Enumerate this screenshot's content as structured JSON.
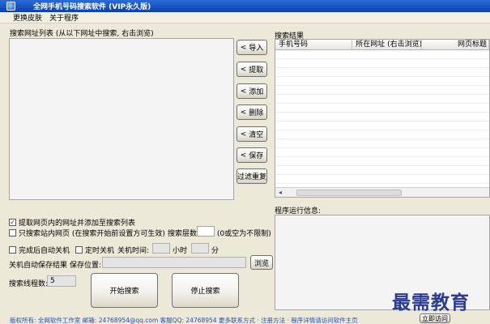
{
  "window": {
    "title": "全网手机号码搜索软件 (VIP永久版)"
  },
  "menu": [
    "更换皮肤",
    "关于程序"
  ],
  "search_list": {
    "label": "搜索网址列表 (从以下网址中搜索, 右击浏览)"
  },
  "side_buttons": {
    "import": "导入",
    "extract": "提取",
    "add": "添加",
    "delete": "删除",
    "clear": "清空",
    "save": "保存",
    "filter": "过滤重复"
  },
  "results": {
    "label": "搜索结果",
    "columns": [
      "手机号码",
      "所在网址 (右击浏览)",
      "网页标题"
    ]
  },
  "run_info": {
    "label": "程序运行信息:"
  },
  "options": {
    "extract_links": {
      "label": "提取网页内的网址并添加至搜索列表",
      "checked": true
    },
    "site_only": {
      "label": "只搜索站内网页 (在搜索开始前设置方可生效)",
      "checked": false
    },
    "depth_label": "搜索层数",
    "depth_hint": "(0或空为不限制)",
    "auto_shutdown": {
      "label": "完成后自动关机",
      "checked": false
    },
    "timed_shutdown": {
      "label": "定时关机",
      "checked": false
    },
    "shutdown_time_label": "关机时间:",
    "hour_label": "小时",
    "minute_label": "分",
    "auto_save_label": "关机自动保存结果",
    "save_path_label": "保存位置:",
    "browse": "浏览",
    "threads_label": "搜索线程数:",
    "threads_value": "5"
  },
  "actions": {
    "start": "开始搜索",
    "stop": "停止搜索"
  },
  "footer": {
    "text": "版权所有: 全网软件工作室   邮箱: 24768954@qq.com  客服QQ: 24768954  更多联系方式 · 注册方法 · 程序详情请访问软件主页",
    "visit": "立即访问"
  },
  "watermark": "最需教育"
}
